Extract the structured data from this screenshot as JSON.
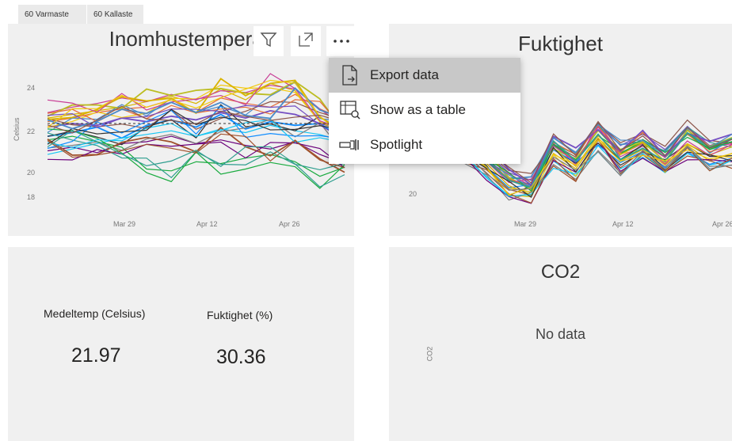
{
  "tabs": [
    "60 Varmaste",
    "60 Kallaste"
  ],
  "temp_chart": {
    "title": "Inomhustemperat",
    "ylabel": "Celsius",
    "y_ticks": [
      "24",
      "22",
      "20",
      "18"
    ],
    "x_ticks": [
      "Mar 29",
      "Apr 12",
      "Apr 26"
    ]
  },
  "humid_chart": {
    "title": "Fuktighet",
    "y_ticks": [
      "20"
    ],
    "x_ticks": [
      "Mar 29",
      "Apr 12",
      "Apr 26"
    ]
  },
  "menu": {
    "items": [
      {
        "label": "Export data",
        "icon": "export-icon"
      },
      {
        "label": "Show as a table",
        "icon": "table-icon"
      },
      {
        "label": "Spotlight",
        "icon": "spotlight-icon"
      }
    ]
  },
  "cards": {
    "medeltemp_label": "Medeltemp (Celsius)",
    "medeltemp_value": "21.97",
    "fukt_label": "Fuktighet (%)",
    "fukt_value": "30.36"
  },
  "co2": {
    "title": "CO2",
    "nodata": "No data",
    "axis_label": "CO2"
  },
  "chart_data": [
    {
      "type": "line",
      "title": "Inomhustemperat",
      "ylabel": "Celsius",
      "ylim": [
        18,
        25
      ],
      "x_ticks": [
        "Mar 29",
        "Apr 12",
        "Apr 26"
      ],
      "series_count_shown": "many",
      "series": [
        {
          "values": [
            21.3,
            21.5,
            21.8,
            21.2,
            21.9,
            22.2,
            21.8,
            22.5,
            21.7,
            22.1,
            21.9,
            22.0,
            21.1
          ]
        },
        {
          "values": [
            22.1,
            22.3,
            22.6,
            22.8,
            22.9,
            23.3,
            22.6,
            23.4,
            23.1,
            22.9,
            23.6,
            22.8,
            22.2
          ]
        },
        {
          "values": [
            20.5,
            20.7,
            20.4,
            20.9,
            21.0,
            21.3,
            20.9,
            21.1,
            20.8,
            20.6,
            21.0,
            20.3,
            19.8
          ]
        },
        {
          "values": [
            21.1,
            21.3,
            21.0,
            20.7,
            19.5,
            19.4,
            19.9,
            19.8,
            20.1,
            20.3,
            19.9,
            19.1,
            19.6
          ]
        },
        {
          "values": [
            22.3,
            22.5,
            22.7,
            22.9,
            23.2,
            23.5,
            23.1,
            23.9,
            23.3,
            24.2,
            23.8,
            22.1,
            21.6
          ]
        },
        {
          "values": [
            21.8,
            22.0,
            21.9,
            22.3,
            22.1,
            22.4,
            22.2,
            22.6,
            22.3,
            22.7,
            22.5,
            22.0,
            21.7
          ]
        },
        {
          "values": [
            20.3,
            20.6,
            20.9,
            21.2,
            21.4,
            21.6,
            21.3,
            21.7,
            21.5,
            21.9,
            21.6,
            21.4,
            21.0
          ]
        },
        {
          "values": [
            22.6,
            22.9,
            23.1,
            23.4,
            23.2,
            23.6,
            23.3,
            23.8,
            23.7,
            24.1,
            23.9,
            22.8,
            21.8
          ]
        }
      ]
    },
    {
      "type": "line",
      "title": "Fuktighet",
      "y_ticks": [
        "20"
      ],
      "x_ticks": [
        "Mar 29",
        "Apr 12",
        "Apr 26"
      ],
      "series": [
        {
          "values": [
            33,
            28,
            22,
            21,
            31,
            27,
            35,
            29,
            32,
            28,
            34,
            30,
            32
          ]
        },
        {
          "values": [
            30,
            25,
            20,
            19,
            29,
            25,
            33,
            27,
            30,
            26,
            31,
            27,
            29
          ]
        },
        {
          "values": [
            35,
            29,
            24,
            22,
            33,
            29,
            37,
            31,
            34,
            30,
            36,
            31,
            33
          ]
        },
        {
          "values": [
            28,
            23,
            18,
            18,
            27,
            23,
            31,
            25,
            28,
            24,
            29,
            26,
            27
          ]
        }
      ]
    }
  ],
  "colors": {
    "panel_bg": "#f0f0f0",
    "accent_blue": "#4a8ac9",
    "menu_active": "#c8c8c8"
  }
}
